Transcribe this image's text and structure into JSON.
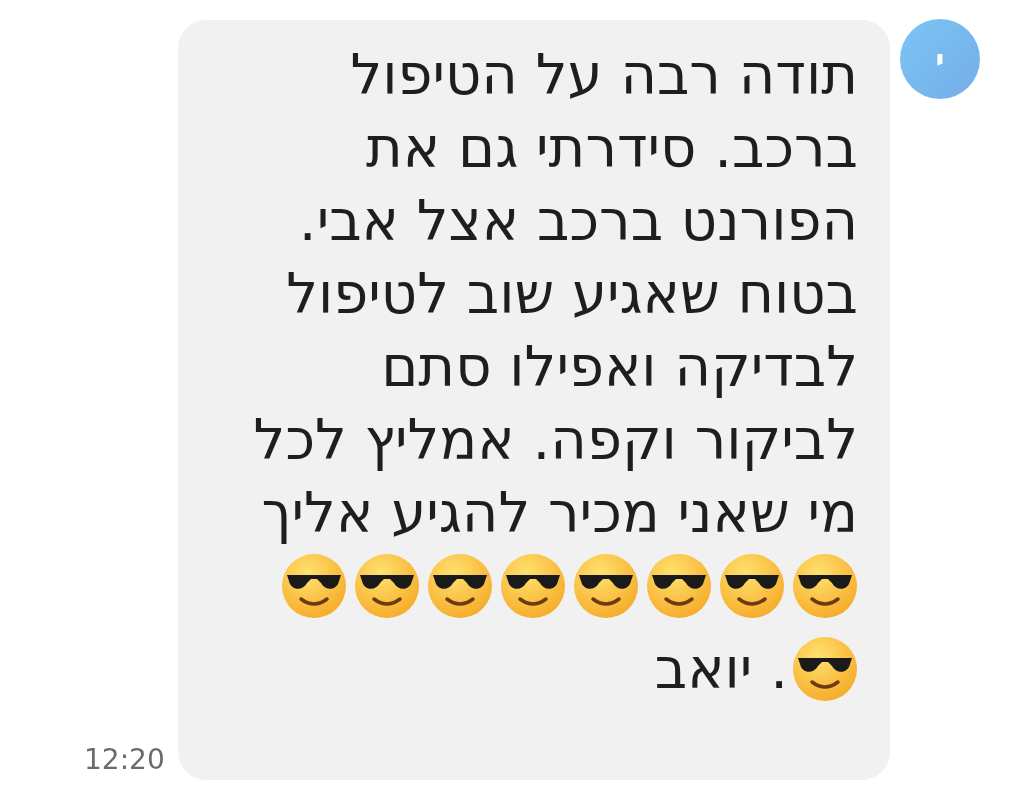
{
  "avatar": {
    "letter": "י"
  },
  "message": {
    "lines": [
      "תודה רבה על הטיפול",
      "ברכב. סידרתי גם את",
      "הפורנט ברכב אצל אבי.",
      "בטוח שאגיע שוב לטיפול",
      "לבדיקה ואפילו סתם",
      "לביקור וקפה. אמליץ לכל",
      "מי שאני מכיר להגיע אליך"
    ],
    "emoji_row": [
      {
        "kind": "sunglasses"
      },
      {
        "kind": "sunglasses"
      },
      {
        "kind": "sunglasses"
      },
      {
        "kind": "sunglasses"
      },
      {
        "kind": "sunglasses"
      },
      {
        "kind": "sunglasses"
      },
      {
        "kind": "sunglasses"
      },
      {
        "kind": "sunglasses"
      }
    ],
    "last_line": {
      "emoji": {
        "kind": "sunglasses"
      },
      "text": ". יואב"
    }
  },
  "time": "12:20"
}
